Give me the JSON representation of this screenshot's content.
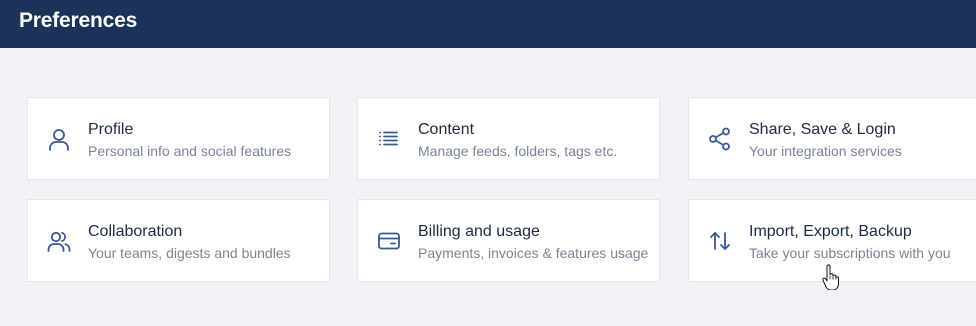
{
  "header": {
    "title": "Preferences"
  },
  "cards": [
    {
      "title": "Profile",
      "description": "Personal info and social features",
      "icon": "user-icon"
    },
    {
      "title": "Content",
      "description": "Manage feeds, folders, tags etc.",
      "icon": "list-icon"
    },
    {
      "title": "Share, Save & Login",
      "description": "Your integration services",
      "icon": "share-icon"
    },
    {
      "title": "Collaboration",
      "description": "Your teams, digests and bundles",
      "icon": "users-icon"
    },
    {
      "title": "Billing and usage",
      "description": "Payments, invoices & features usage",
      "icon": "credit-card-icon"
    },
    {
      "title": "Import, Export, Backup",
      "description": "Take your subscriptions with you",
      "icon": "arrows-up-down-icon"
    }
  ],
  "colors": {
    "header_bg": "#1b3259",
    "page_bg": "#f2f3f6",
    "icon": "#3a5a92",
    "title": "#1d2a44",
    "description": "#7a8495"
  },
  "cursor": "hand-pointer-icon"
}
